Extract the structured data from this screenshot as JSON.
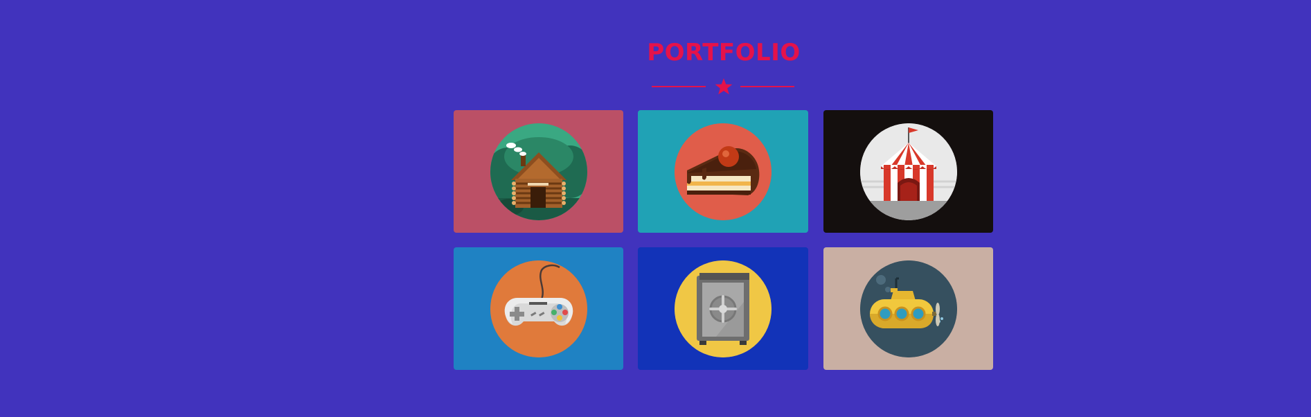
{
  "page": {
    "title": "PORTFOLIO"
  },
  "colors": {
    "background": "#4133bd",
    "accent": "#e5124a"
  },
  "portfolio": {
    "items": [
      {
        "name": "log-cabin",
        "icon": "log-cabin-icon",
        "tile_color": "#bb5066",
        "circle_color": "#2f8f72"
      },
      {
        "name": "cake-slice",
        "icon": "cake-slice-icon",
        "tile_color": "#20a2b5",
        "circle_color": "#e05d4a"
      },
      {
        "name": "circus-tent",
        "icon": "circus-tent-icon",
        "tile_color": "#140f0e",
        "circle_color": "#e9e9e9"
      },
      {
        "name": "game-controller",
        "icon": "game-controller-icon",
        "tile_color": "#1f82c3",
        "circle_color": "#e07a3b"
      },
      {
        "name": "safe",
        "icon": "safe-icon",
        "tile_color": "#1233b8",
        "circle_color": "#f0c745"
      },
      {
        "name": "submarine",
        "icon": "submarine-icon",
        "tile_color": "#c9afa3",
        "circle_color": "#36505f"
      }
    ]
  }
}
